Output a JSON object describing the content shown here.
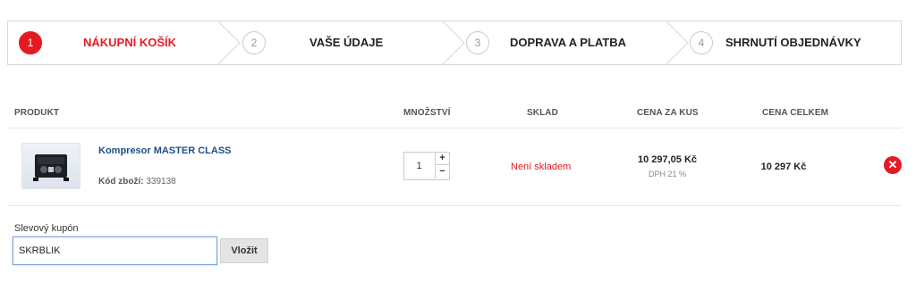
{
  "steps": [
    {
      "number": "1",
      "label": "NÁKUPNÍ KOŠÍK",
      "active": true
    },
    {
      "number": "2",
      "label": "VAŠE ÚDAJE",
      "active": false
    },
    {
      "number": "3",
      "label": "DOPRAVA A PLATBA",
      "active": false
    },
    {
      "number": "4",
      "label": "SHRNUTÍ OBJEDNÁVKY",
      "active": false
    }
  ],
  "table": {
    "headers": {
      "product": "PRODUKT",
      "quantity": "MNOŽSTVÍ",
      "stock": "SKLAD",
      "unit_price": "CENA ZA KUS",
      "total_price": "CENA CELKEM"
    },
    "rows": [
      {
        "name": "Kompresor MASTER CLASS",
        "code_label": "Kód zboží:",
        "code_value": "339138",
        "quantity": "1",
        "plus": "+",
        "minus": "−",
        "stock": "Není skladem",
        "unit_price": "10 297,05 Kč",
        "vat": "DPH 21 %",
        "total_price": "10 297 Kč",
        "remove_icon": "close-icon"
      }
    ]
  },
  "coupon": {
    "label": "Slevový kupón",
    "value": "SKRBLIK",
    "button": "Vložit"
  },
  "colors": {
    "accent": "#e41b22",
    "link": "#1e4f8a"
  }
}
